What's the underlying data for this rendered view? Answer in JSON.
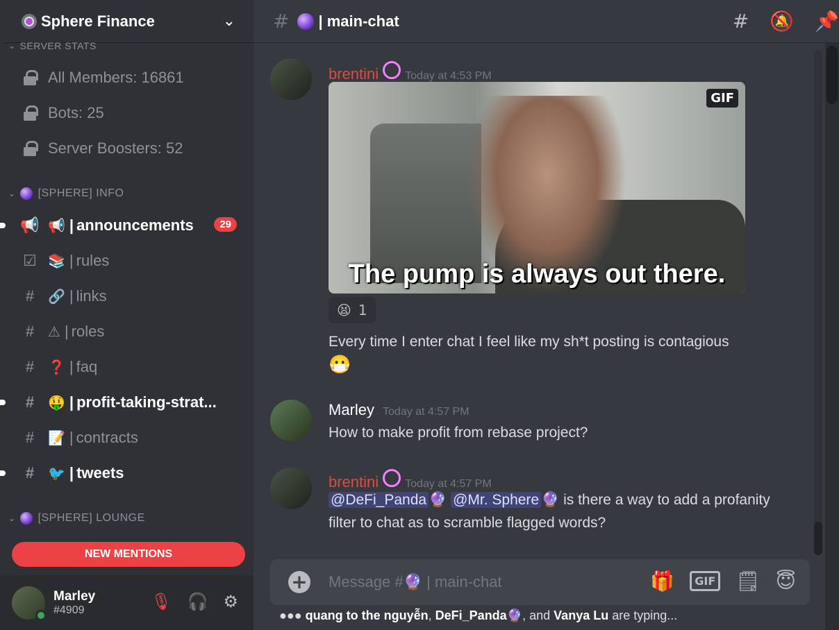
{
  "server": {
    "name": "Sphere Finance"
  },
  "categories": {
    "stats": "SERVER STATS",
    "info": "[SPHERE] INFO",
    "lounge": "[SPHERE] LOUNGE"
  },
  "stats_channels": [
    {
      "label": "All Members: 16861"
    },
    {
      "label": "Bots: 25"
    },
    {
      "label": "Server Boosters: 52"
    }
  ],
  "channels": [
    {
      "emoji": "📢",
      "name": "announcements",
      "badge": "29",
      "unread": true
    },
    {
      "emoji": "📚",
      "name": "rules",
      "unread": false
    },
    {
      "emoji": "🔗",
      "name": "links",
      "unread": false
    },
    {
      "emoji": "⚠",
      "name": "roles",
      "unread": false
    },
    {
      "emoji": "❓",
      "name": "faq",
      "unread": false
    },
    {
      "emoji": "🤑",
      "name": "profit-taking-strat...",
      "unread": true
    },
    {
      "emoji": "📝",
      "name": "contracts",
      "unread": false
    },
    {
      "emoji": "🐦",
      "name": "tweets",
      "unread": true
    }
  ],
  "new_mentions": "NEW MENTIONS",
  "user": {
    "name": "Marley",
    "tag": "#4909"
  },
  "topbar": {
    "channel": "| main-chat"
  },
  "messages": [
    {
      "author": "brentini",
      "time": "Today at 4:53 PM",
      "gif_caption": "The pump is always out there.",
      "gif_tag": "GIF",
      "reaction_count": "1",
      "text": "Every time I enter chat I feel like my sh*t posting is contagious"
    },
    {
      "author": "Marley",
      "time": "Today at 4:57 PM",
      "text": "How to make profit from rebase project?"
    },
    {
      "author": "brentini",
      "time": "Today at 4:57 PM",
      "mention1": "@DeFi_Panda",
      "mention2": "@Mr. Sphere",
      "text": " is there a way to add a profanity filter to chat as to scramble flagged words?"
    }
  ],
  "composer": {
    "placeholder": "Message #🔮 | main-chat",
    "gif": "GIF"
  },
  "typing": {
    "user1": "quang to the nguyễn",
    "user2": "DeFi_Panda",
    "user3": "Vanya Lu",
    "suffix": "are typing..."
  }
}
